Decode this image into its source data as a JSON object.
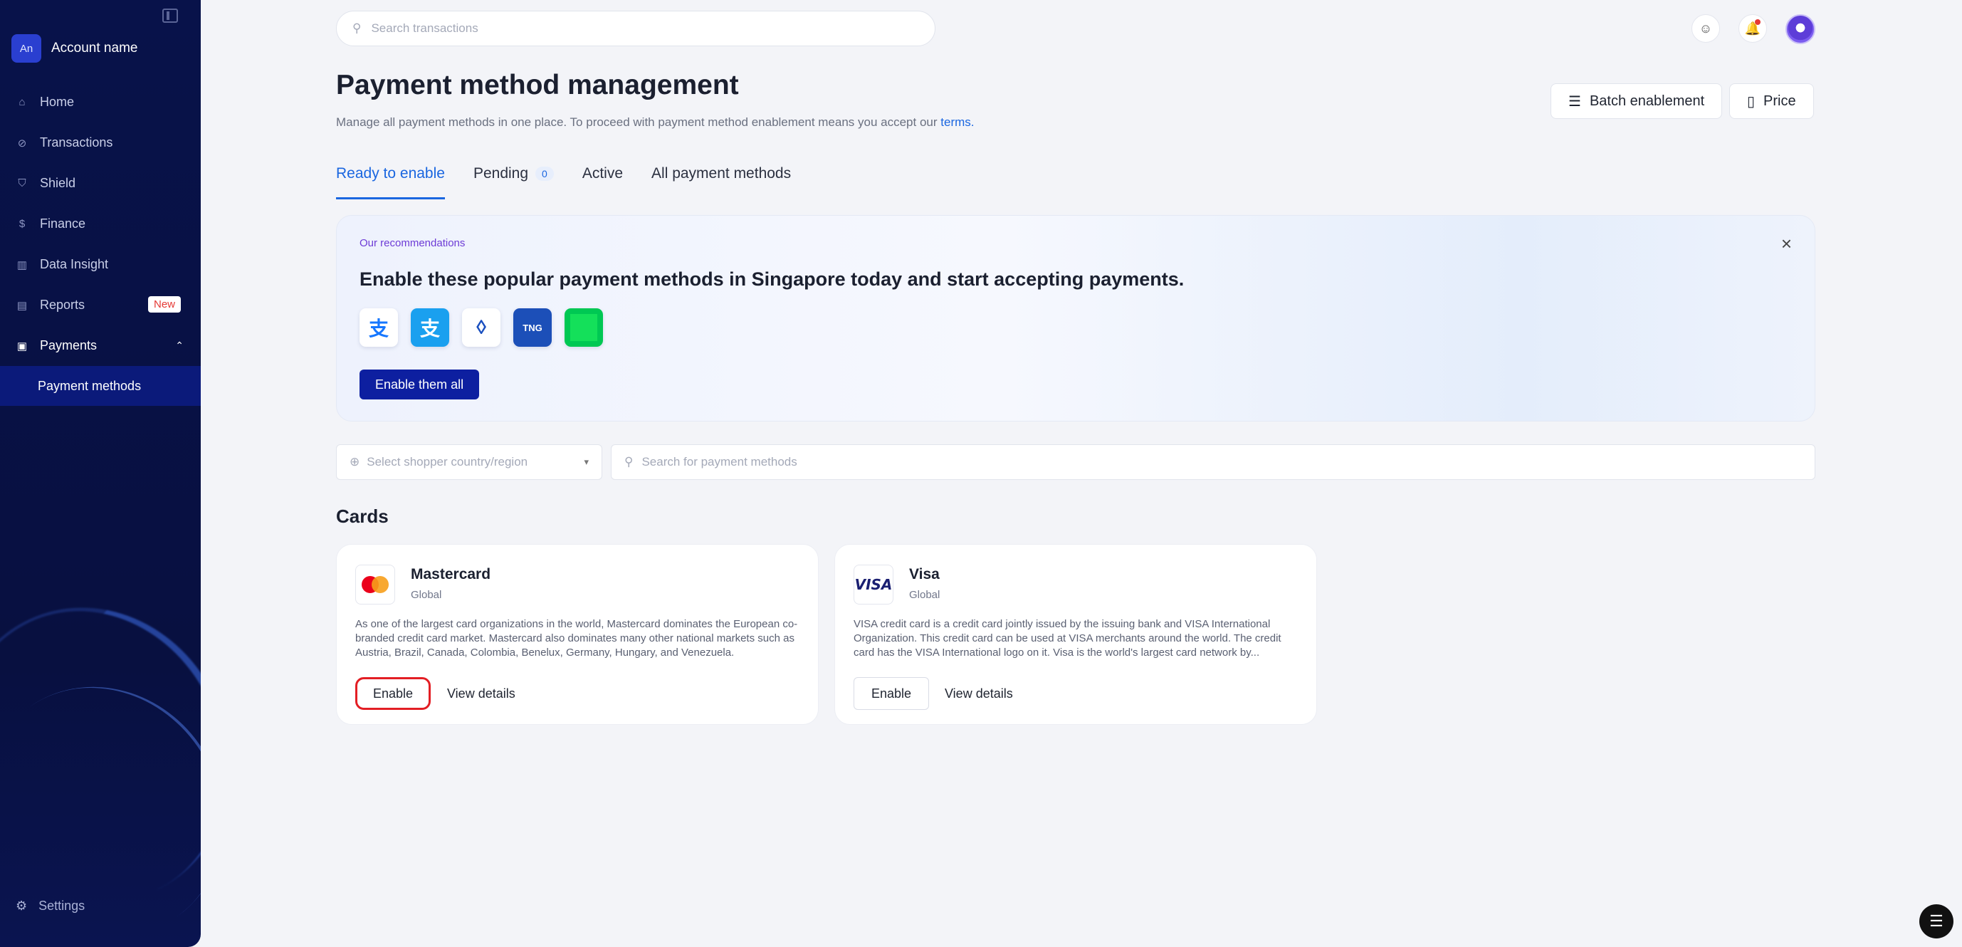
{
  "sidebar": {
    "account_initials": "An",
    "account_name": "Account name",
    "items": [
      {
        "label": "Home",
        "icon": "home-icon"
      },
      {
        "label": "Transactions",
        "icon": "transactions-icon"
      },
      {
        "label": "Shield",
        "icon": "shield-icon"
      },
      {
        "label": "Finance",
        "icon": "finance-icon"
      },
      {
        "label": "Data Insight",
        "icon": "chart-icon"
      },
      {
        "label": "Reports",
        "icon": "reports-icon",
        "badge": "New"
      },
      {
        "label": "Payments",
        "icon": "wallet-icon",
        "expanded": true
      }
    ],
    "sub_items": [
      {
        "label": "Payment methods"
      }
    ],
    "settings_label": "Settings"
  },
  "topbar": {
    "search_placeholder": "Search transactions"
  },
  "header": {
    "title": "Payment method management",
    "subtitle": "Manage all payment methods in one place. To proceed with payment method enablement means you accept our",
    "subtitle_link": "terms.",
    "batch_button": "Batch enablement",
    "price_button": "Price"
  },
  "tabs": [
    {
      "label": "Ready to enable",
      "active": true
    },
    {
      "label": "Pending",
      "count": "0"
    },
    {
      "label": "Active"
    },
    {
      "label": "All payment methods"
    }
  ],
  "banner": {
    "kicker": "Our recommendations",
    "headline": "Enable these popular payment methods in Singapore today and start accepting payments.",
    "icons": [
      "alipay-icon",
      "alipay-hk-icon",
      "krungthai-icon",
      "touch-n-go-icon",
      "grabpay-icon"
    ],
    "button": "Enable them all"
  },
  "filters": {
    "country_placeholder": "Select shopper country/region",
    "search_placeholder": "Search for payment methods"
  },
  "section_title": "Cards",
  "cards": [
    {
      "name": "Mastercard",
      "region": "Global",
      "description": "As one of the largest card organizations in the world, Mastercard dominates the European co-branded credit card market. Mastercard also dominates many other national markets such as Austria, Brazil, Canada, Colombia, Benelux, Germany, Hungary, and Venezuela.",
      "enable_label": "Enable",
      "details_label": "View details"
    },
    {
      "name": "Visa",
      "region": "Global",
      "logo_text": "VISA",
      "description": "VISA credit card is a credit card jointly issued by the issuing bank and VISA International Organization. This credit card can be used at VISA merchants around the world. The credit card has the VISA International logo on it. Visa is the world's largest card network by...",
      "enable_label": "Enable",
      "details_label": "View details"
    }
  ],
  "colors": {
    "sidebar_bg": "#08124a",
    "accent": "#1a66e0",
    "primary_button": "#0d1fa0",
    "highlight": "#e31e24"
  }
}
